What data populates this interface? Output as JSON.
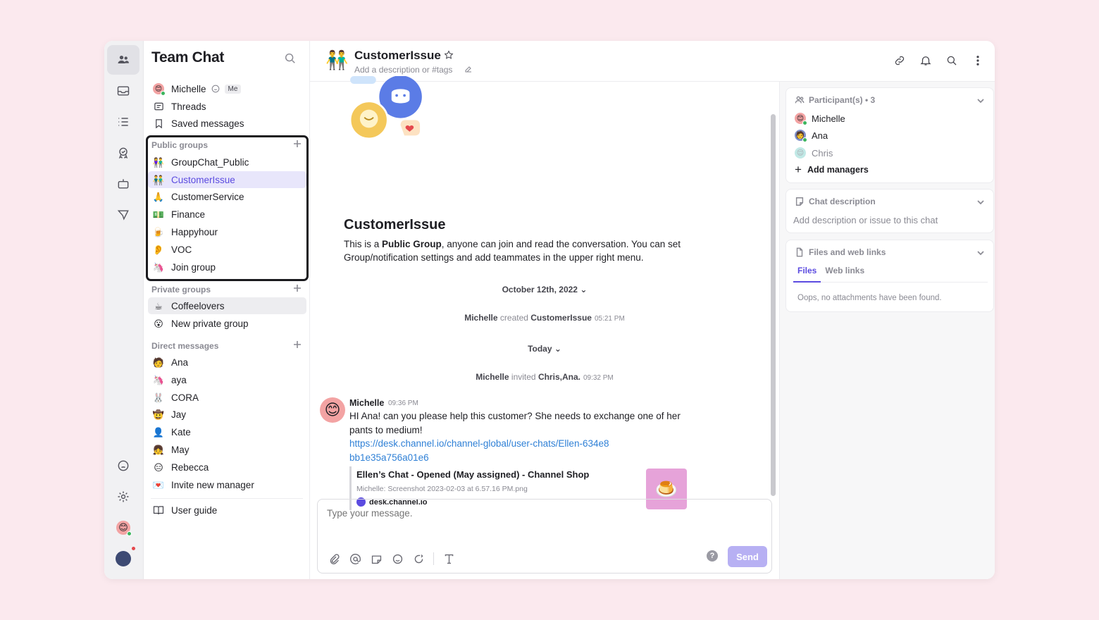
{
  "app": {
    "title": "Team Chat"
  },
  "sidebar": {
    "me": {
      "name": "Michelle",
      "badge": "Me"
    },
    "top_items": [
      {
        "label": "Threads",
        "icon": "threads-icon"
      },
      {
        "label": "Saved messages",
        "icon": "bookmark-icon"
      }
    ],
    "public_groups": {
      "label": "Public groups",
      "items": [
        {
          "label": "GroupChat_Public",
          "emoji": "👫"
        },
        {
          "label": "CustomerIssue",
          "emoji": "👬",
          "selected": true
        },
        {
          "label": "CustomerService",
          "emoji": "🙏"
        },
        {
          "label": "Finance",
          "emoji": "💵"
        },
        {
          "label": "Happyhour",
          "emoji": "🍺"
        },
        {
          "label": "VOC",
          "emoji": "👂"
        },
        {
          "label": "Join group",
          "emoji": "🦄"
        }
      ]
    },
    "private_groups": {
      "label": "Private groups",
      "items": [
        {
          "label": "Coffeelovers",
          "emoji": "☕"
        },
        {
          "label": "New private group",
          "emoji": "😮"
        }
      ]
    },
    "direct_messages": {
      "label": "Direct messages",
      "items": [
        {
          "label": "Ana",
          "emoji": "🧑"
        },
        {
          "label": "aya",
          "emoji": "🦄"
        },
        {
          "label": "CORA",
          "emoji": "🐰"
        },
        {
          "label": "Jay",
          "emoji": "🤠"
        },
        {
          "label": "Kate",
          "emoji": "👤"
        },
        {
          "label": "May",
          "emoji": "👧"
        },
        {
          "label": "Rebecca",
          "emoji": "😑"
        },
        {
          "label": "Invite new manager",
          "emoji": "💌"
        }
      ]
    },
    "user_guide": "User guide"
  },
  "header": {
    "title": "CustomerIssue",
    "description_placeholder": "Add a description or #tags"
  },
  "chat": {
    "intro_title": "CustomerIssue",
    "intro_prefix": "This is a ",
    "intro_bold": "Public Group",
    "intro_suffix": ", anyone can join and read the conversation. You can set Group/notification settings and add teammates in the upper right menu.",
    "date_1": "October 12th, 2022",
    "sys_1": {
      "actor": "Michelle",
      "verb": " created ",
      "target": "CustomerIssue",
      "time": "05:21 PM"
    },
    "date_2": "Today",
    "sys_2": {
      "actor": "Michelle",
      "verb": " invited ",
      "target": "Chris,Ana.",
      "time": "09:32 PM"
    },
    "message": {
      "author": "Michelle",
      "time": "09:36 PM",
      "text": "HI Ana! can you please help this customer? She needs to exchange one of her pants to medium!",
      "link": "https://desk.channel.io/channel-global/user-chats/Ellen-634e8bb1e35a756a01e6",
      "preview": {
        "title": "Ellen’s Chat - Opened (May assigned) - Channel Shop",
        "subtitle": "Michelle: Screenshot 2023-02-03 at 6.57.16 PM.png",
        "site": "desk.channel.io"
      }
    }
  },
  "composer": {
    "placeholder": "Type your message.",
    "send": "Send"
  },
  "right_panel": {
    "participants": {
      "label": "Participant(s) • 3",
      "people": [
        "Michelle",
        "Ana",
        "Chris"
      ],
      "add": "Add managers"
    },
    "description": {
      "label": "Chat description",
      "placeholder": "Add description or issue to this chat"
    },
    "files": {
      "label": "Files and web links",
      "tabs": [
        "Files",
        "Web links"
      ],
      "empty": "Oops, no attachments have been found."
    }
  },
  "colors": {
    "accent": "#5b4be0",
    "background": "#fbe9ee",
    "send_disabled": "#b7b0f3"
  }
}
